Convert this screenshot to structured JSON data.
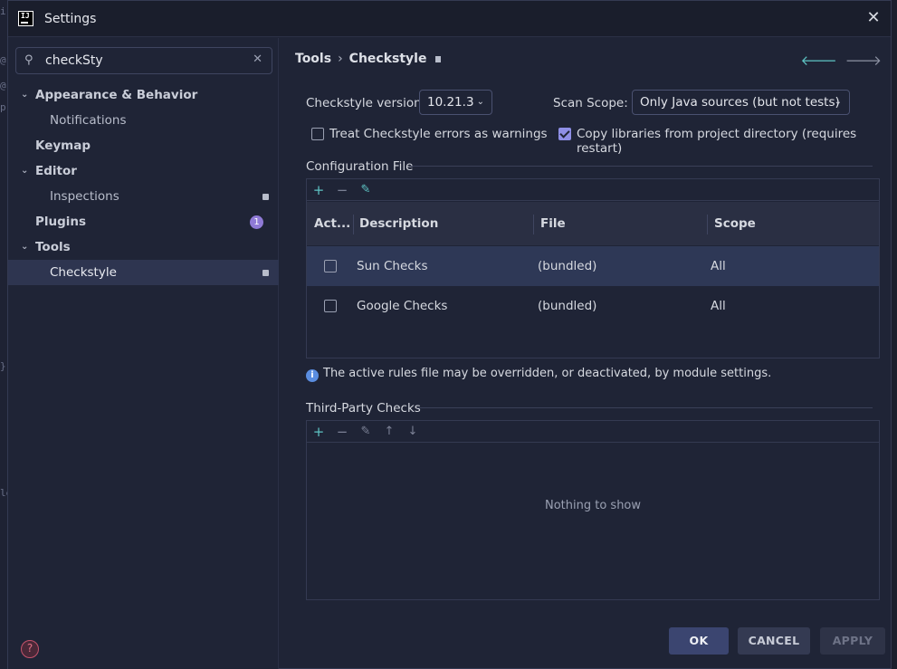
{
  "window": {
    "title": "Settings"
  },
  "search": {
    "value": "checkSty"
  },
  "sidebar": {
    "items": [
      {
        "label": "Appearance & Behavior"
      },
      {
        "label": "Notifications"
      },
      {
        "label": "Keymap"
      },
      {
        "label": "Editor"
      },
      {
        "label": "Inspections"
      },
      {
        "label": "Plugins",
        "badge": "1"
      },
      {
        "label": "Tools"
      },
      {
        "label": "Checkstyle"
      }
    ]
  },
  "breadcrumb": {
    "parent": "Tools",
    "separator": "›",
    "current": "Checkstyle"
  },
  "settings": {
    "version_label": "Checkstyle version:",
    "version_value": "10.21.3",
    "scope_label": "Scan Scope:",
    "scope_value": "Only Java sources (but not tests)",
    "treat_errors_label": "Treat Checkstyle errors as warnings",
    "treat_errors_checked": false,
    "copy_libs_label": "Copy libraries from project directory (requires restart)",
    "copy_libs_checked": true
  },
  "config": {
    "section_title": "Configuration File",
    "columns": [
      "Act...",
      "Description",
      "File",
      "Scope"
    ],
    "rows": [
      {
        "active": false,
        "description": "Sun Checks",
        "file": "(bundled)",
        "scope": "All"
      },
      {
        "active": false,
        "description": "Google Checks",
        "file": "(bundled)",
        "scope": "All"
      }
    ],
    "info": "The active rules file may be overridden, or deactivated, by module settings."
  },
  "third_party": {
    "section_title": "Third-Party Checks",
    "empty_text": "Nothing to show"
  },
  "buttons": {
    "ok": "OK",
    "cancel": "CANCEL",
    "apply": "APPLY"
  },
  "colors": {
    "accent": "#5ec4c4",
    "selection": "#2e3550",
    "badge": "#8f7ad6",
    "checkbox_on": "#8f8fe6"
  }
}
